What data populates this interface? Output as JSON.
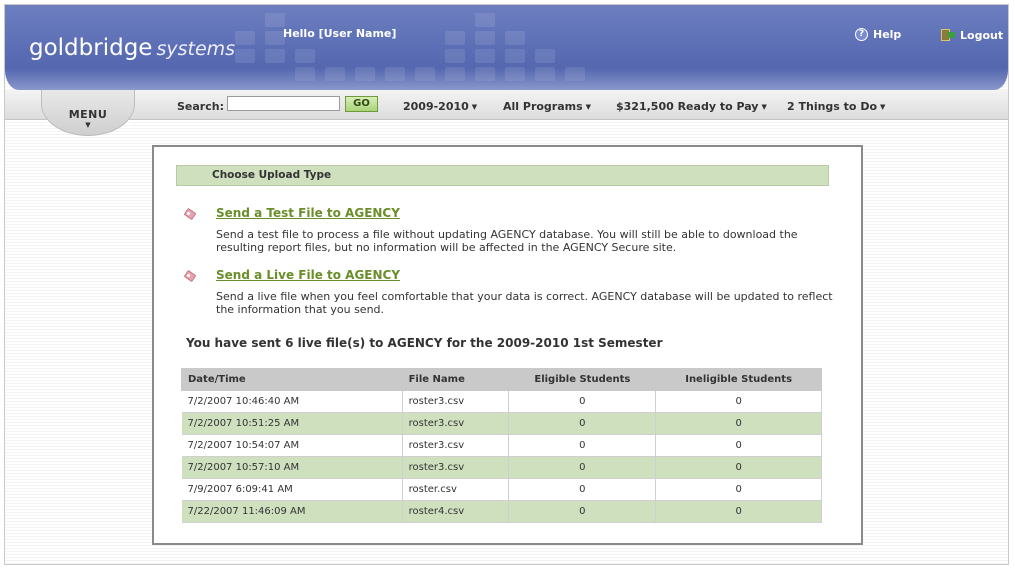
{
  "header": {
    "brand": "goldbridge",
    "brand_suffix": "systems",
    "greeting": "Hello [User Name]",
    "help_label": "Help",
    "logout_label": "Logout"
  },
  "navbar": {
    "menu_label": "MENU",
    "search_label": "Search:",
    "search_value": "",
    "go_label": "GO",
    "year": "2009-2010",
    "programs": "All Programs",
    "ready_to_pay": "$321,500 Ready to Pay",
    "things_to_do": "2 Things to Do"
  },
  "main": {
    "upload_heading": "Choose Upload Type",
    "test_file": {
      "link": "Send a Test File to AGENCY",
      "desc": "Send a test file to process a file without updating AGENCY database. You will still be able to download the resulting report files, but no information will be affected in the AGENCY Secure site."
    },
    "live_file": {
      "link": "Send a Live File to AGENCY",
      "desc": "Send a live file when you feel comfortable that your data is correct. AGENCY database will be updated to reflect the information that you send."
    },
    "sent_summary": "You have sent 6 live file(s) to AGENCY for the 2009-2010 1st Semester",
    "table": {
      "headers": [
        "Date/Time",
        "File Name",
        "Eligible Students",
        "Ineligible Students"
      ],
      "rows": [
        [
          "7/2/2007 10:46:40 AM",
          "roster3.csv",
          "0",
          "0"
        ],
        [
          "7/2/2007 10:51:25 AM",
          "roster3.csv",
          "0",
          "0"
        ],
        [
          "7/2/2007 10:54:07 AM",
          "roster3.csv",
          "0",
          "0"
        ],
        [
          "7/2/2007 10:57:10 AM",
          "roster3.csv",
          "0",
          "0"
        ],
        [
          "7/9/2007 6:09:41 AM",
          "roster.csv",
          "0",
          "0"
        ],
        [
          "7/22/2007 11:46:09 AM",
          "roster4.csv",
          "0",
          "0"
        ]
      ]
    }
  },
  "colors": {
    "header_blue": "#5a6db4",
    "accent_green": "#cfe0bf",
    "link_green": "#6a8e2a"
  }
}
